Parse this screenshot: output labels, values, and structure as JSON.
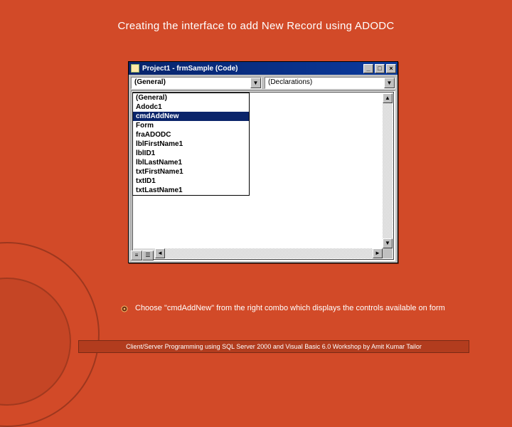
{
  "slide": {
    "title": "Creating the interface to add New Record using ADODC"
  },
  "codeWindow": {
    "title": "Project1 - frmSample (Code)",
    "winButtons": {
      "min": "_",
      "max": "□",
      "close": "×"
    },
    "leftCombo": {
      "text": "(General)",
      "arrow": "▼"
    },
    "rightCombo": {
      "text": "(Declarations)",
      "arrow": "▼"
    },
    "dropdownItems": [
      "(General)",
      "Adodc1",
      "cmdAddNew",
      "Form",
      "fraADODC",
      "lblFirstName1",
      "lblID1",
      "lblLastName1",
      "txtFirstName1",
      "txtID1",
      "txtLastName1"
    ],
    "selectedIndex": 2,
    "scrollArrows": {
      "up": "▲",
      "down": "▼",
      "left": "◄",
      "right": "►"
    },
    "viewTabs": {
      "proc": "≡",
      "full": "☰"
    }
  },
  "bullet": {
    "text": "Choose \"cmdAddNew\" from the right combo which displays the controls available on form"
  },
  "footer": {
    "text": "Client/Server Programming using SQL Server 2000 and Visual Basic 6.0 Workshop by Amit Kumar Tailor"
  }
}
